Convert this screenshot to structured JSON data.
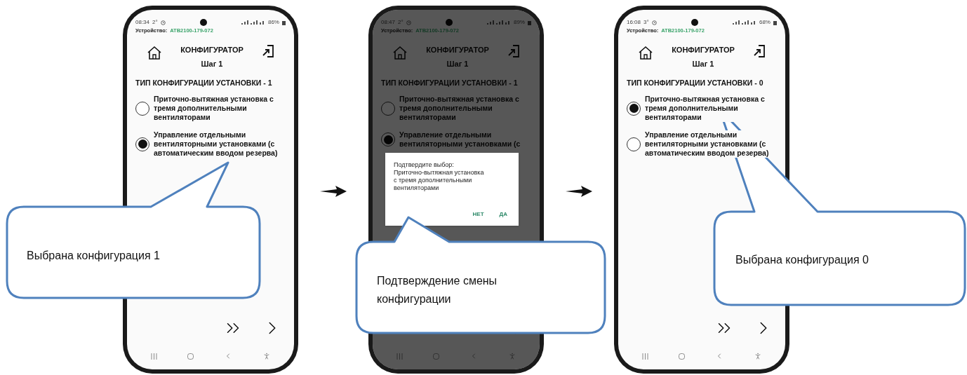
{
  "screens": [
    {
      "time": "08:34",
      "temp": "2°",
      "battery": "86%",
      "device_label": "Устройство:",
      "device_id": "ATB2100-179-072",
      "title": "КОНФИГУРАТОР",
      "step": "Шаг 1",
      "section": "ТИП КОНФИГУРАЦИИ УСТАНОВКИ - 1",
      "dimmed": false,
      "options": [
        {
          "label": "Приточно-вытяжная установка с тремя дополнительными вентиляторами",
          "selected": false
        },
        {
          "label": "Управление отдельными вентиляторными установками (с автоматическим вводом резерва)",
          "selected": true
        }
      ]
    },
    {
      "time": "08:47",
      "temp": "2°",
      "battery": "89%",
      "device_label": "Устройство:",
      "device_id": "ATB2100-179-072",
      "title": "КОНФИГУРАТОР",
      "step": "Шаг 1",
      "section": "ТИП КОНФИГУРАЦИИ УСТАНОВКИ - 1",
      "dimmed": true,
      "options": [
        {
          "label": "Приточно-вытяжная установка с тремя дополнительными вентиляторами",
          "selected": false
        },
        {
          "label": "Управление отдельными вентиляторными установками (с",
          "selected": true
        }
      ],
      "dialog": {
        "message": "Подтвердите выбор:\nПриточно-вытяжная установка\nс тремя дополнительными\nвентиляторами",
        "buttons": [
          "НЕТ",
          "ДА"
        ]
      }
    },
    {
      "time": "16:08",
      "temp": "3°",
      "battery": "68%",
      "device_label": "Устройство:",
      "device_id": "ATB2100-179-072",
      "title": "КОНФИГУРАТОР",
      "step": "Шаг 1",
      "section": "ТИП КОНФИГУРАЦИИ УСТАНОВКИ - 0",
      "dimmed": false,
      "options": [
        {
          "label": "Приточно-вытяжная установка с тремя дополнительными вентиляторами",
          "selected": true
        },
        {
          "label": "Управление отдельными вентиляторными установками (с автоматическим вводом резерва)",
          "selected": false
        }
      ]
    }
  ],
  "callouts": [
    {
      "text": "Выбрана конфигурация 1"
    },
    {
      "text": "Подтверждение смены конфигурации"
    },
    {
      "text": "Выбрана конфигурация 0"
    }
  ]
}
